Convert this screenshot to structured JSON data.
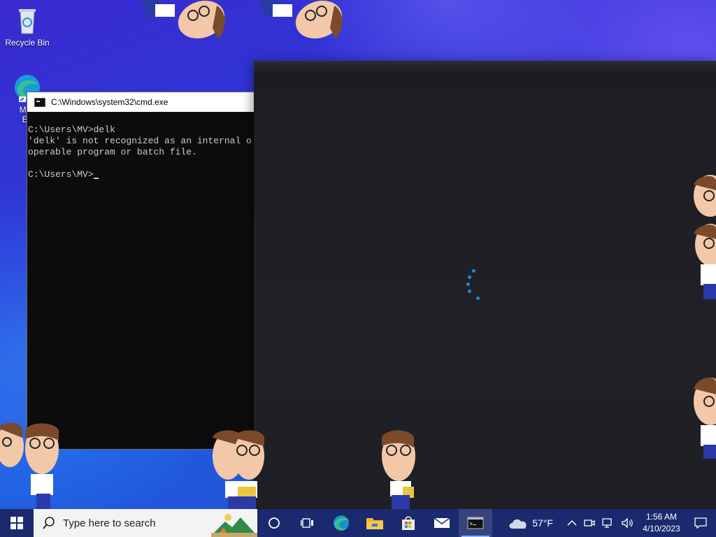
{
  "desktop": {
    "recycle_bin_label": "Recycle Bin",
    "edge_label_line1": "Micr",
    "edge_label_line2": "Ed"
  },
  "cmd_window": {
    "title": "C:\\Windows\\system32\\cmd.exe",
    "lines": [
      "C:\\Users\\MV>delk",
      "'delk' is not recognized as an internal o",
      "operable program or batch file.",
      "",
      "C:\\Users\\MV>"
    ]
  },
  "taskbar": {
    "search_placeholder": "Type here to search",
    "pinned": [
      {
        "name": "task-view-button",
        "icon": "task-view-icon"
      },
      {
        "name": "edge-button",
        "icon": "edge-icon"
      },
      {
        "name": "file-explorer-button",
        "icon": "folder-icon"
      },
      {
        "name": "store-button",
        "icon": "store-icon"
      },
      {
        "name": "mail-button",
        "icon": "mail-icon"
      },
      {
        "name": "cmd-taskbar-button",
        "icon": "terminal-icon"
      }
    ]
  },
  "tray": {
    "weather_temp": "57°F",
    "time": "1:56 AM",
    "date": "4/10/2023"
  },
  "colors": {
    "taskbar": "#1b2a6e",
    "spinner": "#1b8ad6",
    "console_bg": "#0c0c0c",
    "console_text": "#cccccc"
  }
}
